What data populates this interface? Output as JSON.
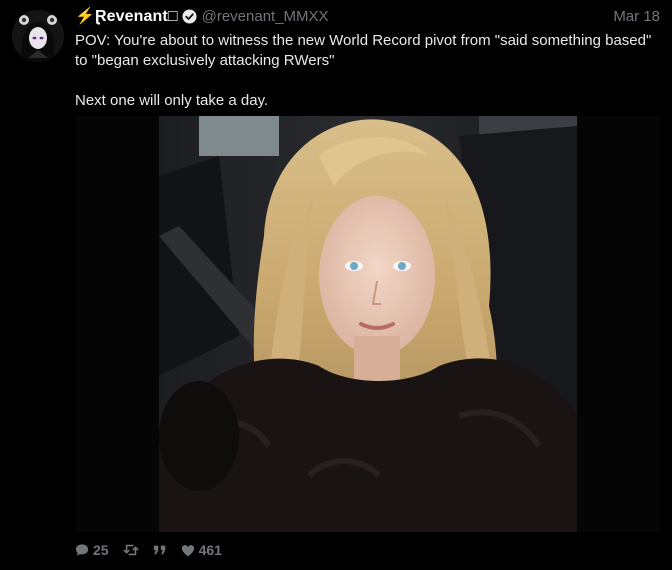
{
  "tweet": {
    "display_name": "⚡Ɽevenant□",
    "handle": "@revenant_MMXX",
    "date": "Mar 18",
    "text_line1": "POV: You're about to witness the new World Record pivot from \"said something based\" to \"began exclusively attacking RWers\"",
    "text_line2": "Next one will only take a day."
  },
  "actions": {
    "replies": "25",
    "likes": "461"
  },
  "icons": {
    "verified": "verified-badge-icon",
    "reply": "reply-bubble-icon",
    "retweet": "retweet-icon",
    "quote": "quote-icon",
    "like": "heart-icon"
  },
  "colors": {
    "background": "#000000",
    "text": "#e7e9ea",
    "muted": "#71767b"
  }
}
